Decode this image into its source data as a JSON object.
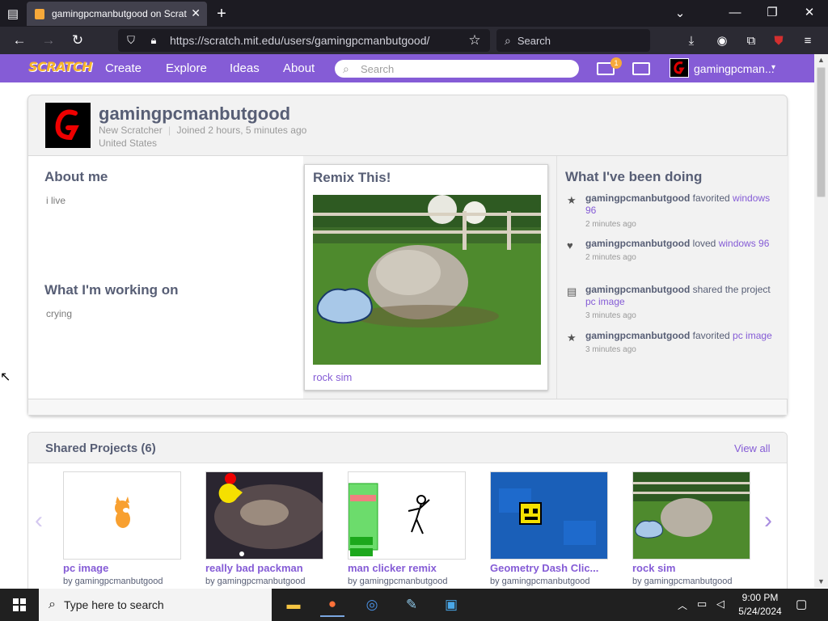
{
  "browser": {
    "tab_title": "gamingpcmanbutgood on Scrat",
    "url": "https://scratch.mit.edu/users/gamingpcmanbutgood/",
    "search_placeholder": "Search"
  },
  "scratch_nav": {
    "logo": "SCRATCH",
    "links": [
      "Create",
      "Explore",
      "Ideas",
      "About"
    ],
    "search_placeholder": "Search",
    "notification_count": "1",
    "username": "gamingpcman..."
  },
  "profile": {
    "username": "gamingpcmanbutgood",
    "status": "New Scratcher",
    "joined": "Joined 2 hours, 5 minutes ago",
    "location": "United States",
    "about_title": "About me",
    "about_text": "i live",
    "working_title": "What I'm working on",
    "working_text": "crying",
    "remix_title": "Remix This!",
    "remix_project": "rock sim",
    "activity_title": "What I've been doing",
    "activity": [
      {
        "user": "gamingpcmanbutgood",
        "action": "favorited",
        "target": "windows 96",
        "time": "2 minutes ago",
        "icon": "star-icon"
      },
      {
        "user": "gamingpcmanbutgood",
        "action": "loved",
        "target": "windows 96",
        "time": "2 minutes ago",
        "icon": "heart-icon"
      },
      {
        "user": "gamingpcmanbutgood",
        "action": "shared the project",
        "target": "pc image",
        "time": "3 minutes ago",
        "icon": "share-icon"
      },
      {
        "user": "gamingpcmanbutgood",
        "action": "favorited",
        "target": "pc image",
        "time": "3 minutes ago",
        "icon": "star-icon"
      }
    ]
  },
  "shared": {
    "title": "Shared Projects (6)",
    "view_all": "View all",
    "projects": [
      {
        "title": "pc image",
        "by": "by gamingpcmanbutgood"
      },
      {
        "title": "really bad packman",
        "by": "by gamingpcmanbutgood"
      },
      {
        "title": "man clicker remix",
        "by": "by gamingpcmanbutgood"
      },
      {
        "title": "Geometry Dash Clic...",
        "by": "by gamingpcmanbutgood"
      },
      {
        "title": "rock sim",
        "by": "by gamingpcmanbutgood"
      }
    ]
  },
  "taskbar": {
    "search_placeholder": "Type here to search",
    "time": "9:00 PM",
    "date": "5/24/2024"
  }
}
